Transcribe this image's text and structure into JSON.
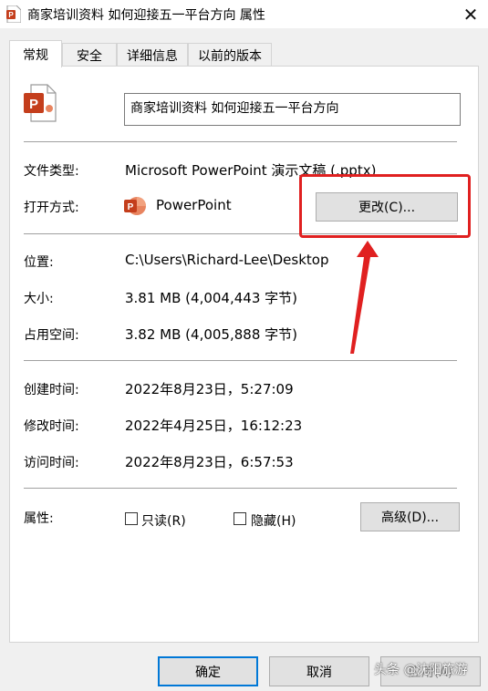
{
  "window": {
    "title": "商家培训资料 如何迎接五一平台方向 属性",
    "close_glyph": "✕"
  },
  "tabs": [
    {
      "label": "常规",
      "active": true
    },
    {
      "label": "安全",
      "active": false
    },
    {
      "label": "详细信息",
      "active": false
    },
    {
      "label": "以前的版本",
      "active": false
    }
  ],
  "general": {
    "file_name": "商家培训资料 如何迎接五一平台方向",
    "file_type_label": "文件类型:",
    "file_type_value": "Microsoft PowerPoint 演示文稿 (.pptx)",
    "open_with_label": "打开方式:",
    "open_with_value": "PowerPoint",
    "change_button": "更改(C)...",
    "location_label": "位置:",
    "location_value": "C:\\Users\\Richard-Lee\\Desktop",
    "size_label": "大小:",
    "size_value": "3.81 MB (4,004,443 字节)",
    "disk_size_label": "占用空间:",
    "disk_size_value": "3.82 MB (4,005,888 字节)",
    "created_label": "创建时间:",
    "created_value": "2022年8月23日，5:27:09",
    "modified_label": "修改时间:",
    "modified_value": "2022年4月25日，16:12:23",
    "accessed_label": "访问时间:",
    "accessed_value": "2022年8月23日，6:57:53",
    "attributes_label": "属性:",
    "readonly_label": "只读(R)",
    "hidden_label": "隐藏(H)",
    "advanced_button": "高级(D)..."
  },
  "footer": {
    "ok": "确定",
    "cancel": "取消",
    "apply": "应用(A)"
  },
  "watermark": "头条 @沈阳旅游",
  "colors": {
    "highlight": "#e02020",
    "accent": "#0078d7",
    "powerpoint": "#c43e1c"
  },
  "icons": {
    "app": "powerpoint-file-icon",
    "open_with": "powerpoint-app-icon"
  }
}
